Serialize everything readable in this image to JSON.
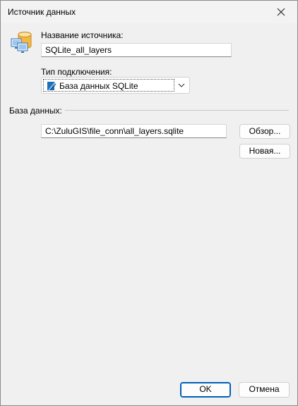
{
  "window": {
    "title": "Источник данных"
  },
  "source": {
    "name_label": "Название источника:",
    "name_value": "SQLite_all_layers",
    "connection_type_label": "Тип подключения:",
    "connection_type_value": "База данных SQLite"
  },
  "database": {
    "section_label": "База данных:",
    "path_value": "C:\\ZuluGIS\\file_conn\\all_layers.sqlite",
    "browse_label": "Обзор...",
    "new_label": "Новая..."
  },
  "footer": {
    "ok_label": "OK",
    "cancel_label": "Отмена"
  },
  "icons": [
    "database-icon",
    "close-icon",
    "sqlite-icon",
    "chevron-down-icon"
  ]
}
